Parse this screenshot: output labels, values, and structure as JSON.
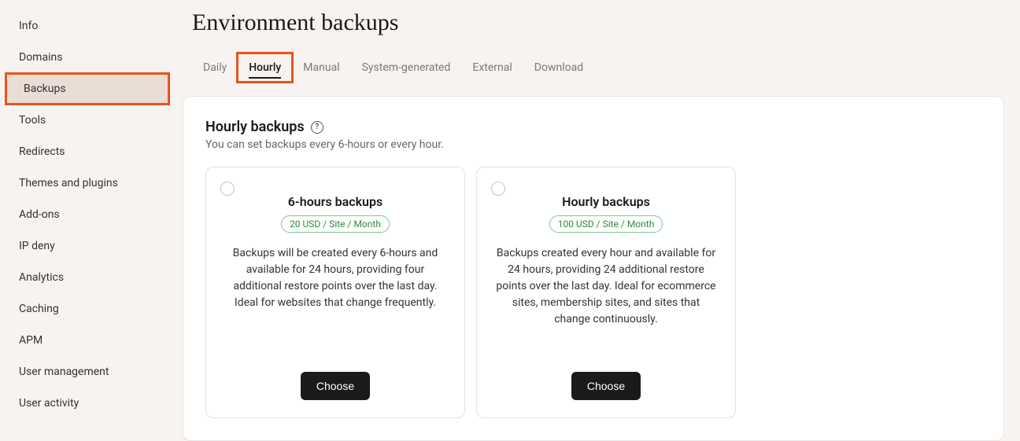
{
  "sidebar": {
    "items": [
      {
        "label": "Info"
      },
      {
        "label": "Domains"
      },
      {
        "label": "Backups",
        "active": true
      },
      {
        "label": "Tools"
      },
      {
        "label": "Redirects"
      },
      {
        "label": "Themes and plugins"
      },
      {
        "label": "Add-ons"
      },
      {
        "label": "IP deny"
      },
      {
        "label": "Analytics"
      },
      {
        "label": "Caching"
      },
      {
        "label": "APM"
      },
      {
        "label": "User management"
      },
      {
        "label": "User activity"
      }
    ]
  },
  "page": {
    "title": "Environment backups"
  },
  "tabs": [
    {
      "label": "Daily"
    },
    {
      "label": "Hourly",
      "active": true
    },
    {
      "label": "Manual"
    },
    {
      "label": "System-generated"
    },
    {
      "label": "External"
    },
    {
      "label": "Download"
    }
  ],
  "section": {
    "title": "Hourly backups",
    "help": "?",
    "subtitle": "You can set backups every 6-hours or every hour."
  },
  "plans": [
    {
      "title": "6-hours backups",
      "price": "20 USD / Site / Month",
      "desc": "Backups will be created every 6-hours and available for 24 hours, providing four additional restore points over the last day. Ideal for websites that change frequently.",
      "button": "Choose"
    },
    {
      "title": "Hourly backups",
      "price": "100 USD / Site / Month",
      "desc": "Backups created every hour and available for 24 hours, providing 24 additional restore points over the last day. Ideal for ecommerce sites, membership sites, and sites that change continuously.",
      "button": "Choose"
    }
  ]
}
